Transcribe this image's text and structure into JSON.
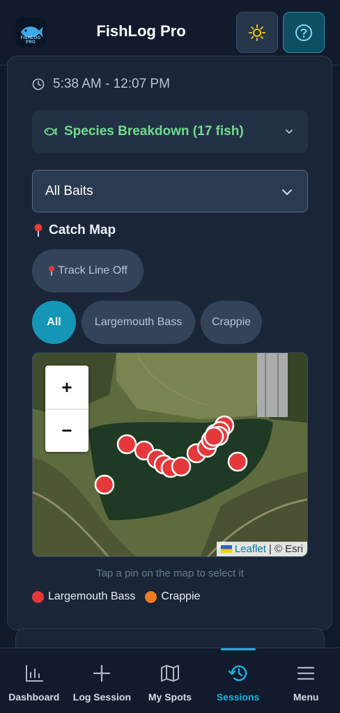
{
  "header": {
    "title": "FishLog Pro",
    "logo_text": "FISHLOG PRO"
  },
  "session": {
    "time_range": "5:38 AM - 12:07 PM",
    "species_breakdown": "Species Breakdown (17 fish)",
    "bait_filter": "All Baits"
  },
  "catch_map": {
    "title": "Catch Map",
    "track_button": "Track Line Off",
    "filters": [
      "All",
      "Largemouth Bass",
      "Crappie"
    ],
    "selected_filter": "All",
    "zoom_in": "+",
    "zoom_out": "−",
    "attribution_link": "Leaflet",
    "attribution_rest": "| © Esri",
    "hint": "Tap a pin on the map to select it",
    "legend": [
      {
        "label": "Largemouth Bass",
        "color": "#e5383b"
      },
      {
        "label": "Crappie",
        "color": "#f07c22"
      }
    ]
  },
  "nav": {
    "items": [
      {
        "label": "Dashboard",
        "icon": "bar-chart-icon"
      },
      {
        "label": "Log Session",
        "icon": "plus-icon"
      },
      {
        "label": "My Spots",
        "icon": "map-icon"
      },
      {
        "label": "Sessions",
        "icon": "history-icon"
      },
      {
        "label": "Menu",
        "icon": "menu-icon"
      }
    ],
    "active": "Sessions"
  },
  "colors": {
    "accent": "#19b4dc",
    "species_green": "#6fdc8c",
    "pin_red": "#e5383b"
  }
}
